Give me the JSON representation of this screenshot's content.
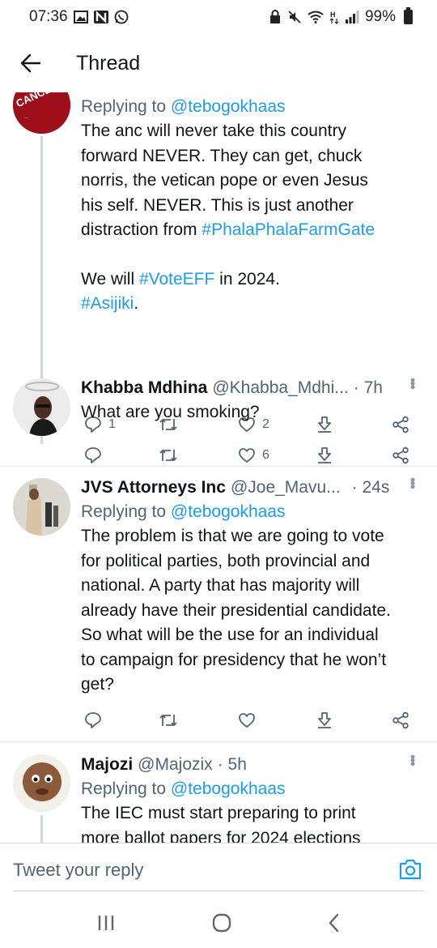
{
  "status_bar": {
    "time": "07:36",
    "battery": "99%"
  },
  "header": {
    "title": "Thread"
  },
  "tweets": [
    {
      "reply_prefix": "Replying to",
      "reply_mention": "@tebogokhaas",
      "lines": [
        "The anc will never take this country",
        "forward NEVER. They can get, chuck",
        "norris, the vetican pope or even Jesus",
        "his self. NEVER. This is just another"
      ],
      "line5_prefix": "distraction from ",
      "line5_hashtag": "#PhalaPhalaFarmGate",
      "line6_prefix": "We will ",
      "line6_hashtag": "#VoteEFF",
      "line6_suffix": " in 2024.",
      "line7_hashtag": "#Asijiki",
      "line7_suffix": ".",
      "replies": "1",
      "likes": "2"
    },
    {
      "name": "Khabba Mdhina",
      "handle": "@Khabba_Mdhi...",
      "time": "· 7h",
      "text": "What are you smoking?",
      "likes": "6"
    },
    {
      "name": "JVS Attorneys Inc",
      "handle": "@Joe_Mavu...",
      "time": "· 24s",
      "reply_prefix": "Replying to",
      "reply_mention": "@tebogokhaas",
      "lines": [
        "The problem is that we are going to vote",
        "for political parties, both provincial and",
        "national. A party that has majority will",
        "already have their presidential candidate.",
        "So what will be the use for an individual",
        "to campaign for presidency that he won’t",
        "get?"
      ]
    },
    {
      "name": "Majozi",
      "handle": "@Majozix",
      "time": "· 5h",
      "reply_prefix": "Replying to",
      "reply_mention": "@tebogokhaas",
      "lines": [
        "The IEC must start preparing to print",
        "more ballot papers for 2024 elections"
      ]
    }
  ],
  "reply_bar": {
    "placeholder": "Tweet your reply"
  },
  "colors": {
    "accent": "#1d9bf0",
    "text": "#0f1419",
    "muted": "#536471"
  }
}
